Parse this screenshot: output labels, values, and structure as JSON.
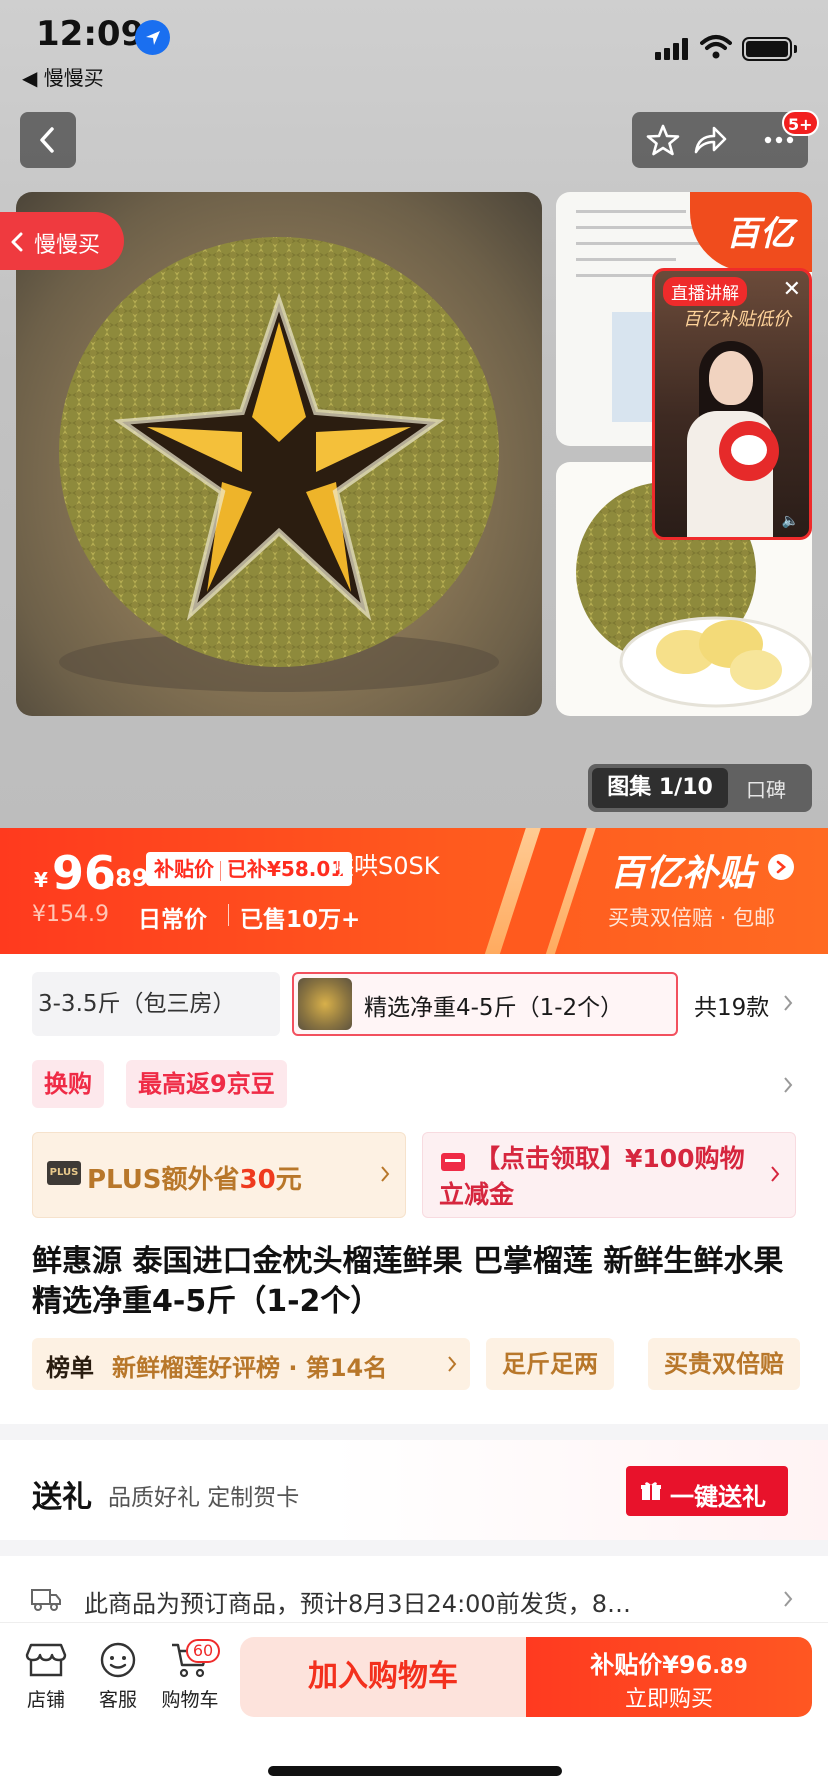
{
  "status_bar": {
    "time": "12:09",
    "back_app": "◀ 慢慢买"
  },
  "nav": {
    "message_badge": "5+"
  },
  "gallery": {
    "side_pill": "慢慢买",
    "bybt_corner": "百亿",
    "live_tag": "直播讲解",
    "live_banner": "百亿补贴低价",
    "album_active": "图集 1/10",
    "album_inactive": "口碑"
  },
  "price": {
    "currency": "¥",
    "integer": "96",
    "decimal": ".89",
    "subsidy_label": "补贴价",
    "subsidy_amount": "已补¥58.01",
    "overlay_code": "哄哄S0SK",
    "original_price": "¥154.9",
    "regular_label": "日常价",
    "sold": "已售10万+",
    "logo": "百亿补贴",
    "logo_sub": "买贵双倍赔 · 包邮"
  },
  "specs": {
    "option_1": "3-3.5斤（包三房）",
    "selected": "精选净重4-5斤（1-2个）",
    "count": "共19款"
  },
  "tags": {
    "exchange": "换购",
    "jd_beans": "最高返9京豆"
  },
  "promos": {
    "plus_icon": "PLUS",
    "plus_text": "PLUS额外省",
    "plus_amount": "30",
    "plus_unit": "元",
    "coupon_text": "【点击领取】¥100购物立减金"
  },
  "product": {
    "title": "鲜惠源 泰国进口金枕头榴莲鲜果 巴掌榴莲  新鲜生鲜水果 精选净重4-5斤（1-2个）"
  },
  "ranking": {
    "label": "榜单",
    "text": "新鲜榴莲好评榜 · 第14名",
    "feature_1": "足斤足两",
    "feature_2": "买贵双倍赔"
  },
  "gift": {
    "title": "送礼",
    "subtitle": "品质好礼 定制贺卡",
    "button": "一键送礼"
  },
  "shipping": {
    "text": "此商品为预订商品，预计8月3日24:00前发货，8…"
  },
  "bottom_bar": {
    "store": "店铺",
    "service": "客服",
    "cart": "购物车",
    "cart_count": "60",
    "add_to_cart": "加入购物车",
    "buy_price_label": "补贴价¥96",
    "buy_price_decimal": ".89",
    "buy_now": "立即购买"
  },
  "colors": {
    "accent": "#ff3a1e",
    "subsidy_red": "#e8122b",
    "gold_text": "#b8772a"
  }
}
